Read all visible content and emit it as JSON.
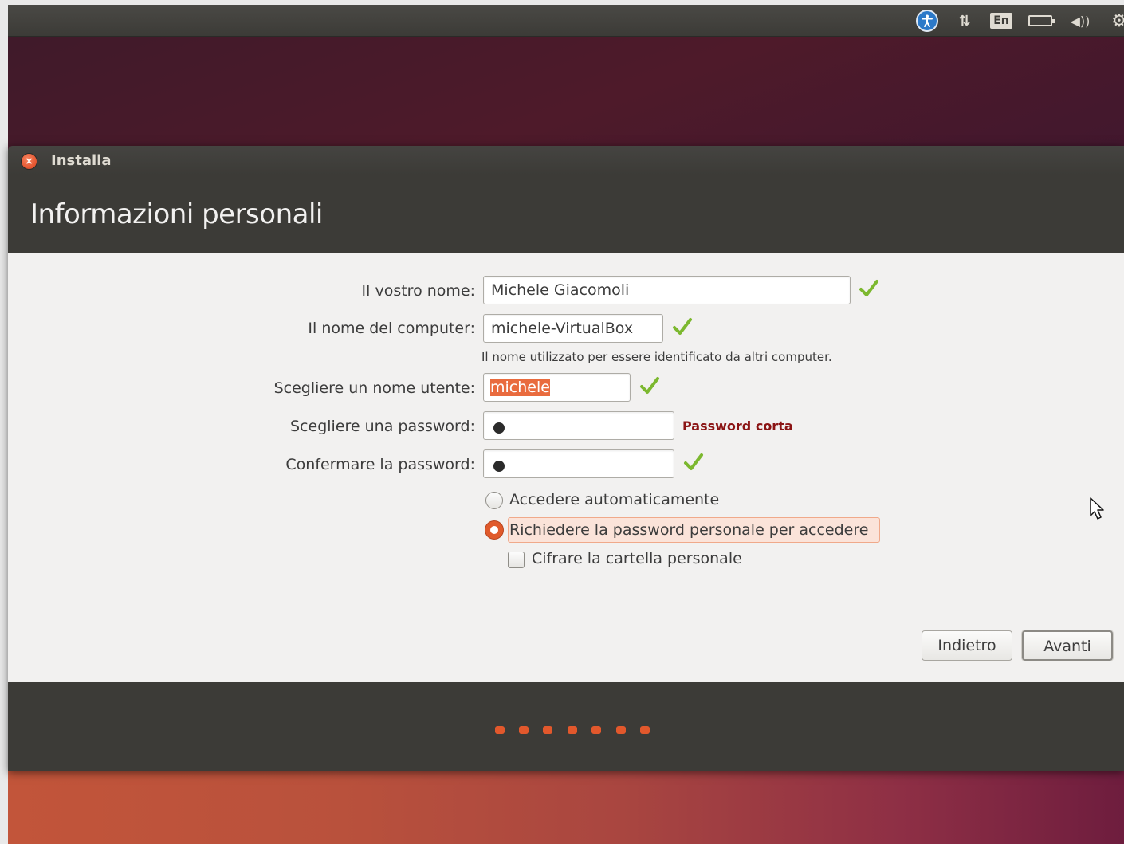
{
  "panel": {
    "indicators": [
      "accessibility-icon",
      "network-icon",
      "keyboard-layout-icon",
      "battery-icon",
      "volume-icon",
      "settings-gear-icon"
    ],
    "keyboard_layout": "En",
    "network_glyph": "⇅",
    "volume_glyph": "◀))",
    "gear_glyph": "⚙"
  },
  "window": {
    "title": "Installa",
    "close_glyph": "×",
    "page_title": "Informazioni personali"
  },
  "form": {
    "name_label": "Il vostro nome:",
    "name_value": "Michele Giacomoli",
    "computer_label": "Il nome del computer:",
    "computer_value": "michele-VirtualBox",
    "computer_hint": "Il nome utilizzato per essere identificato da altri computer.",
    "username_label": "Scegliere un nome utente:",
    "username_value": "michele",
    "password_label": "Scegliere una password:",
    "password_warning": "Password corta",
    "confirm_label": "Confermare la password:",
    "auto_login_label": "Accedere automaticamente",
    "require_password_label": "Richiedere la password personale per accedere",
    "encrypt_label": "Cifrare la cartella personale",
    "selected_option": "require_password",
    "encrypt_checked": false
  },
  "buttons": {
    "back": "Indietro",
    "next": "Avanti"
  },
  "progress": {
    "dots": 7
  },
  "colors": {
    "accent": "#e05a2b",
    "panel": "#3c3b37",
    "check_green": "#7cb82f",
    "warning": "#8b1414"
  }
}
